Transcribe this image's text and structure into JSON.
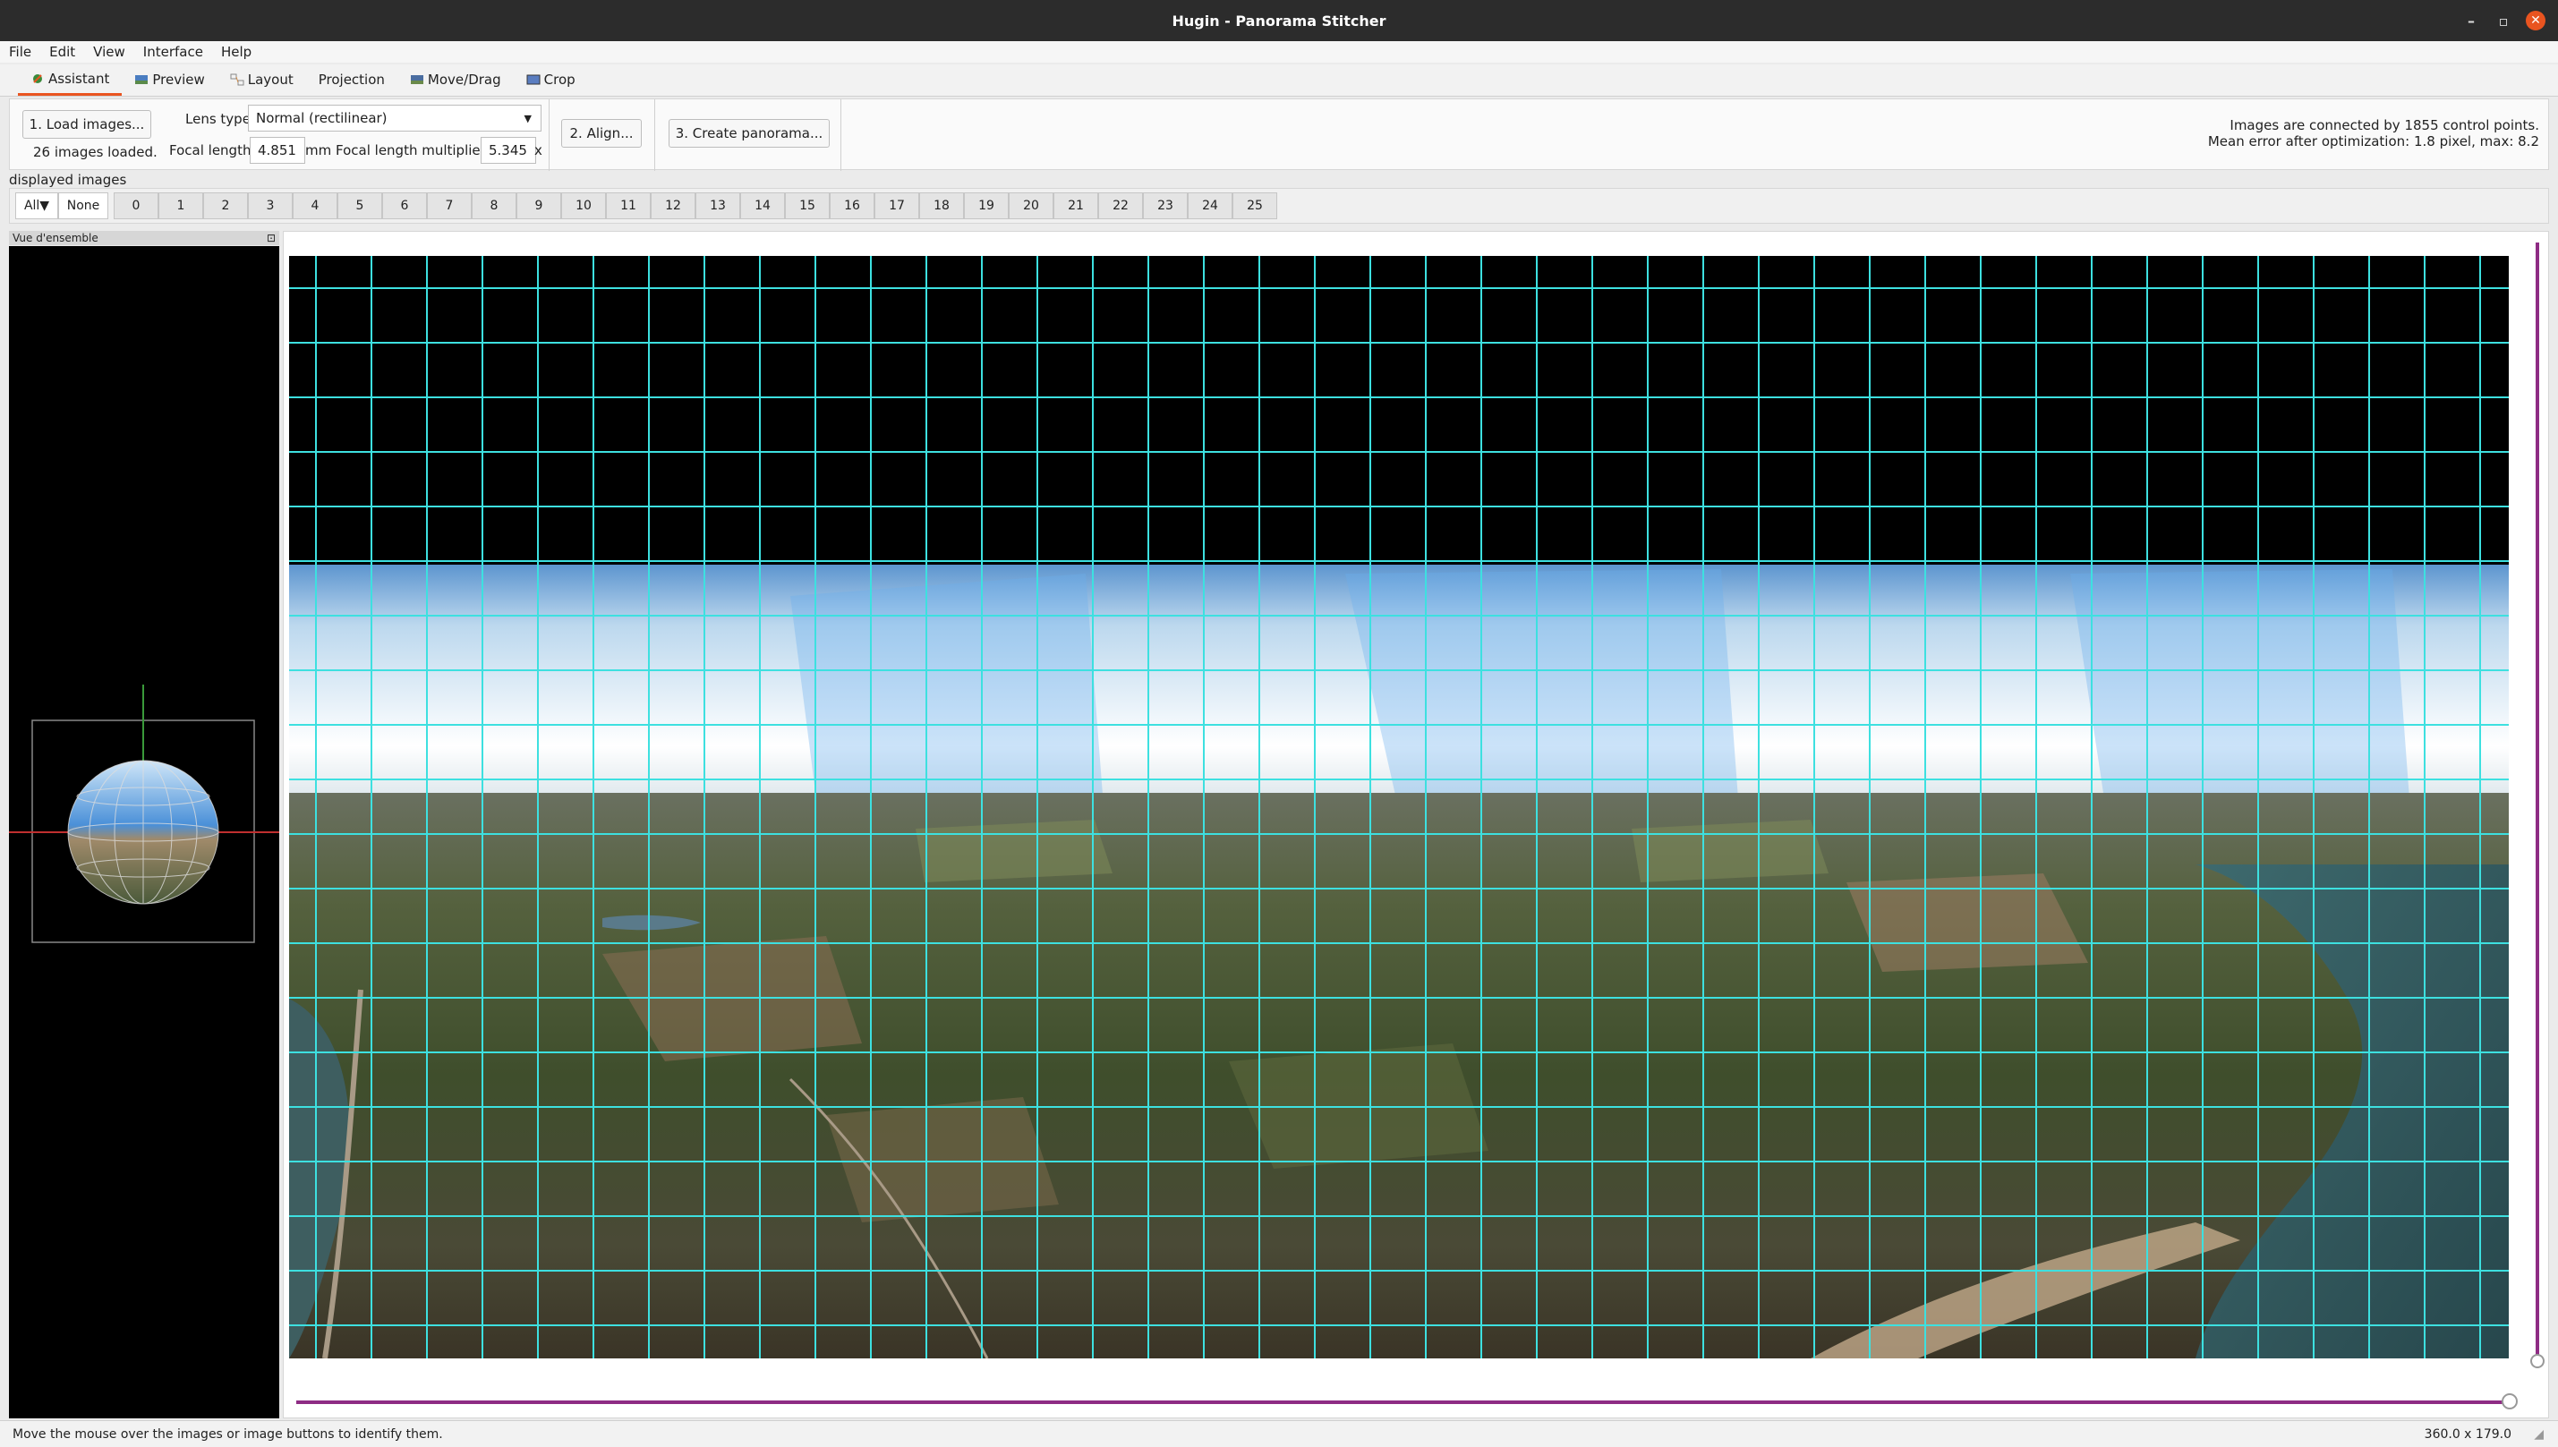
{
  "window": {
    "title": "Hugin - Panorama Stitcher"
  },
  "menu": [
    "File",
    "Edit",
    "View",
    "Interface",
    "Help"
  ],
  "tabs": [
    {
      "label": "Assistant",
      "icon": "assistant-icon"
    },
    {
      "label": "Preview",
      "icon": "preview-icon"
    },
    {
      "label": "Layout",
      "icon": "layout-icon"
    },
    {
      "label": "Projection",
      "icon": ""
    },
    {
      "label": "Move/Drag",
      "icon": "move-drag-icon"
    },
    {
      "label": "Crop",
      "icon": "crop-icon"
    }
  ],
  "assistant": {
    "load_button": "1. Load images...",
    "images_loaded": "26 images loaded.",
    "lens_type_label": "Lens type:",
    "lens_type_value": "Normal (rectilinear)",
    "focal_length_label": "Focal length:",
    "focal_length_value": "4.851",
    "focal_length_unit": "mm",
    "multiplier_label": "Focal length multiplier:",
    "multiplier_value": "5.345",
    "multiplier_unit": "x",
    "align_button": "2. Align...",
    "create_button": "3. Create panorama...",
    "status_line1": "Images are connected by 1855 control points.",
    "status_line2": "Mean error after optimization: 1.8 pixel, max: 8.2"
  },
  "displayed_images": {
    "label": "displayed images",
    "all_button": "All▼",
    "none_button": "None",
    "numbers": [
      "0",
      "1",
      "2",
      "3",
      "4",
      "5",
      "6",
      "7",
      "8",
      "9",
      "10",
      "11",
      "12",
      "13",
      "14",
      "15",
      "16",
      "17",
      "18",
      "19",
      "20",
      "21",
      "22",
      "23",
      "24",
      "25"
    ]
  },
  "overview": {
    "title": "Vue d'ensemble"
  },
  "statusbar": {
    "message": "Move the mouse over the images or image buttons to identify them.",
    "fov": "360.0 x 179.0"
  },
  "colors": {
    "accent": "#e95420",
    "slider": "#8e2c84",
    "grid": "#3de0e0"
  }
}
